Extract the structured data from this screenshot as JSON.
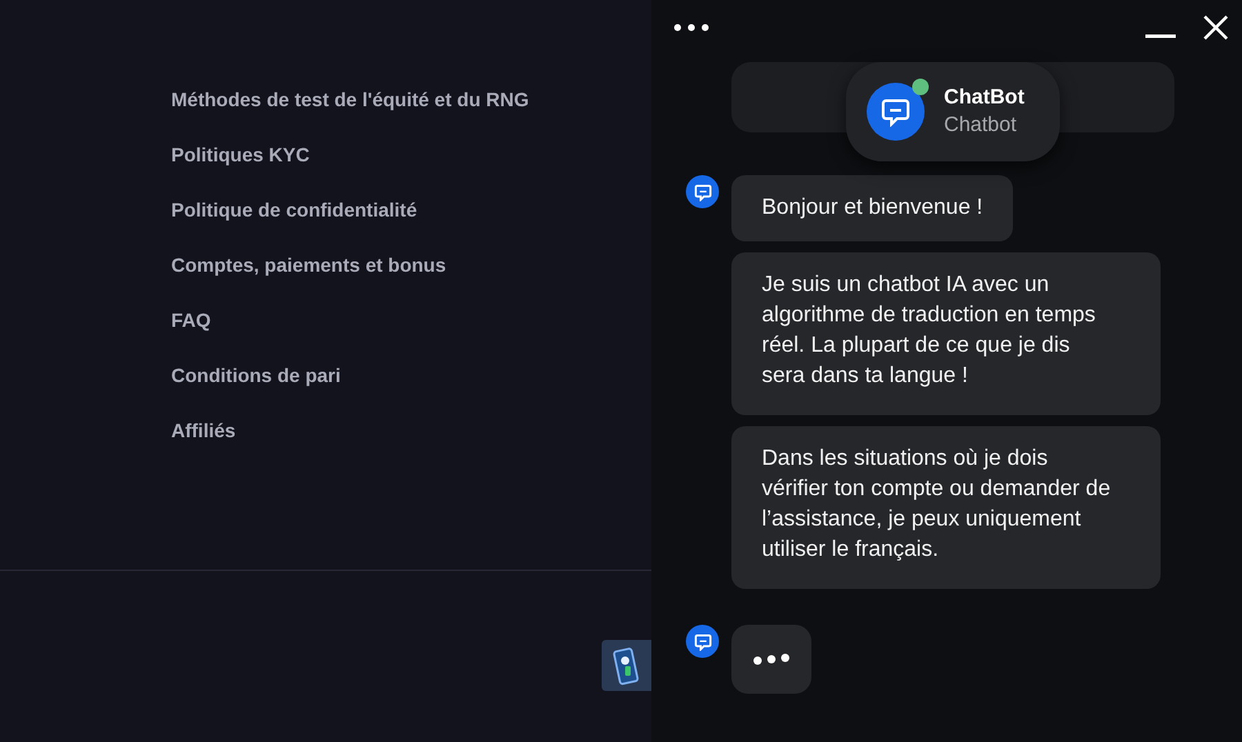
{
  "menu_links": [
    "Méthodes de test de l'équité et du RNG",
    "Politiques KYC",
    "Politique de confidentialité",
    "Comptes, paiements et bonus",
    "FAQ",
    "Conditions de pari",
    "Affiliés"
  ],
  "chat": {
    "bot": {
      "name": "ChatBot",
      "subtitle": "Chatbot",
      "online": true
    },
    "messages": [
      {
        "text": "Bonjour et bienvenue !"
      },
      {
        "text": "Je suis un chatbot IA avec un algorithme de traduction en temps réel. La plupart de ce que je dis sera dans ta langue !"
      },
      {
        "text": "Dans les situations où je dois vérifier ton compte ou demander de l’assistance, je peux uniquement utiliser le français."
      }
    ],
    "typing": true
  }
}
